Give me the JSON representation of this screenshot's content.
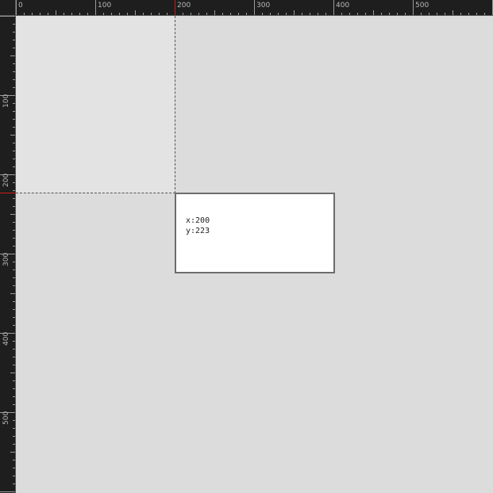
{
  "ruler": {
    "labels": [
      "0",
      "100",
      "200",
      "300",
      "400",
      "500"
    ],
    "marker_color": "#d01818"
  },
  "cursor_readout": {
    "x_label": "x:200",
    "y_label": "y:223"
  }
}
